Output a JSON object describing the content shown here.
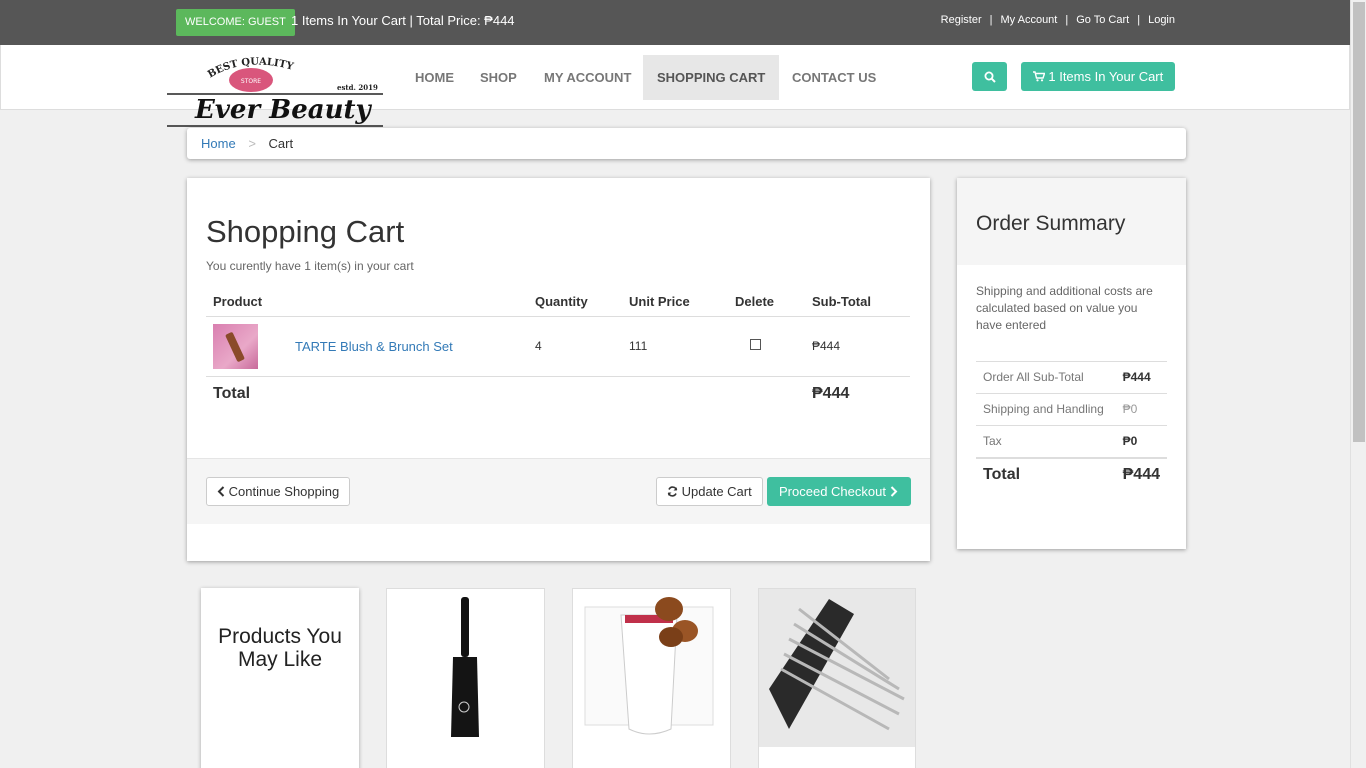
{
  "topbar": {
    "welcome": "WELCOME: GUEST",
    "cart_info": "1 Items In Your Cart | Total Price: ₱444",
    "links": [
      "Register",
      "My Account",
      "Go To Cart",
      "Login"
    ]
  },
  "logo": {
    "top_text": "BEST QUALITY",
    "store": "STORE",
    "estd": "estd. 2019",
    "name": "Ever Beauty"
  },
  "nav": {
    "items": [
      "HOME",
      "SHOP",
      "MY ACCOUNT",
      "SHOPPING CART",
      "CONTACT US"
    ],
    "active": "SHOPPING CART",
    "cart_button": "1 Items In Your Cart"
  },
  "breadcrumb": {
    "home": "Home",
    "current": "Cart"
  },
  "cart": {
    "title": "Shopping Cart",
    "subtitle": "You curently have 1 item(s) in your cart",
    "headers": [
      "Product",
      "Quantity",
      "Unit Price",
      "Delete",
      "Sub-Total"
    ],
    "rows": [
      {
        "name": "TARTE Blush & Brunch Set",
        "quantity": "4",
        "unit_price": "111",
        "subtotal": "₱444"
      }
    ],
    "total_label": "Total",
    "total_value": "₱444",
    "continue_label": "Continue Shopping",
    "update_label": "Update Cart",
    "checkout_label": "Proceed Checkout"
  },
  "summary": {
    "title": "Order Summary",
    "note": "Shipping and additional costs are calculated based on value you have entered",
    "rows": [
      {
        "label": "Order All Sub-Total",
        "value": "₱444"
      },
      {
        "label": "Shipping and Handling",
        "value": "₱0"
      },
      {
        "label": "Tax",
        "value": "₱0"
      }
    ],
    "total_label": "Total",
    "total_value": "₱444"
  },
  "recommended": {
    "title": "Products You May Like"
  },
  "colors": {
    "topbar": "#565656",
    "accent": "#3fbf9f",
    "welcome": "#5cb85c",
    "link": "#337ab7"
  }
}
